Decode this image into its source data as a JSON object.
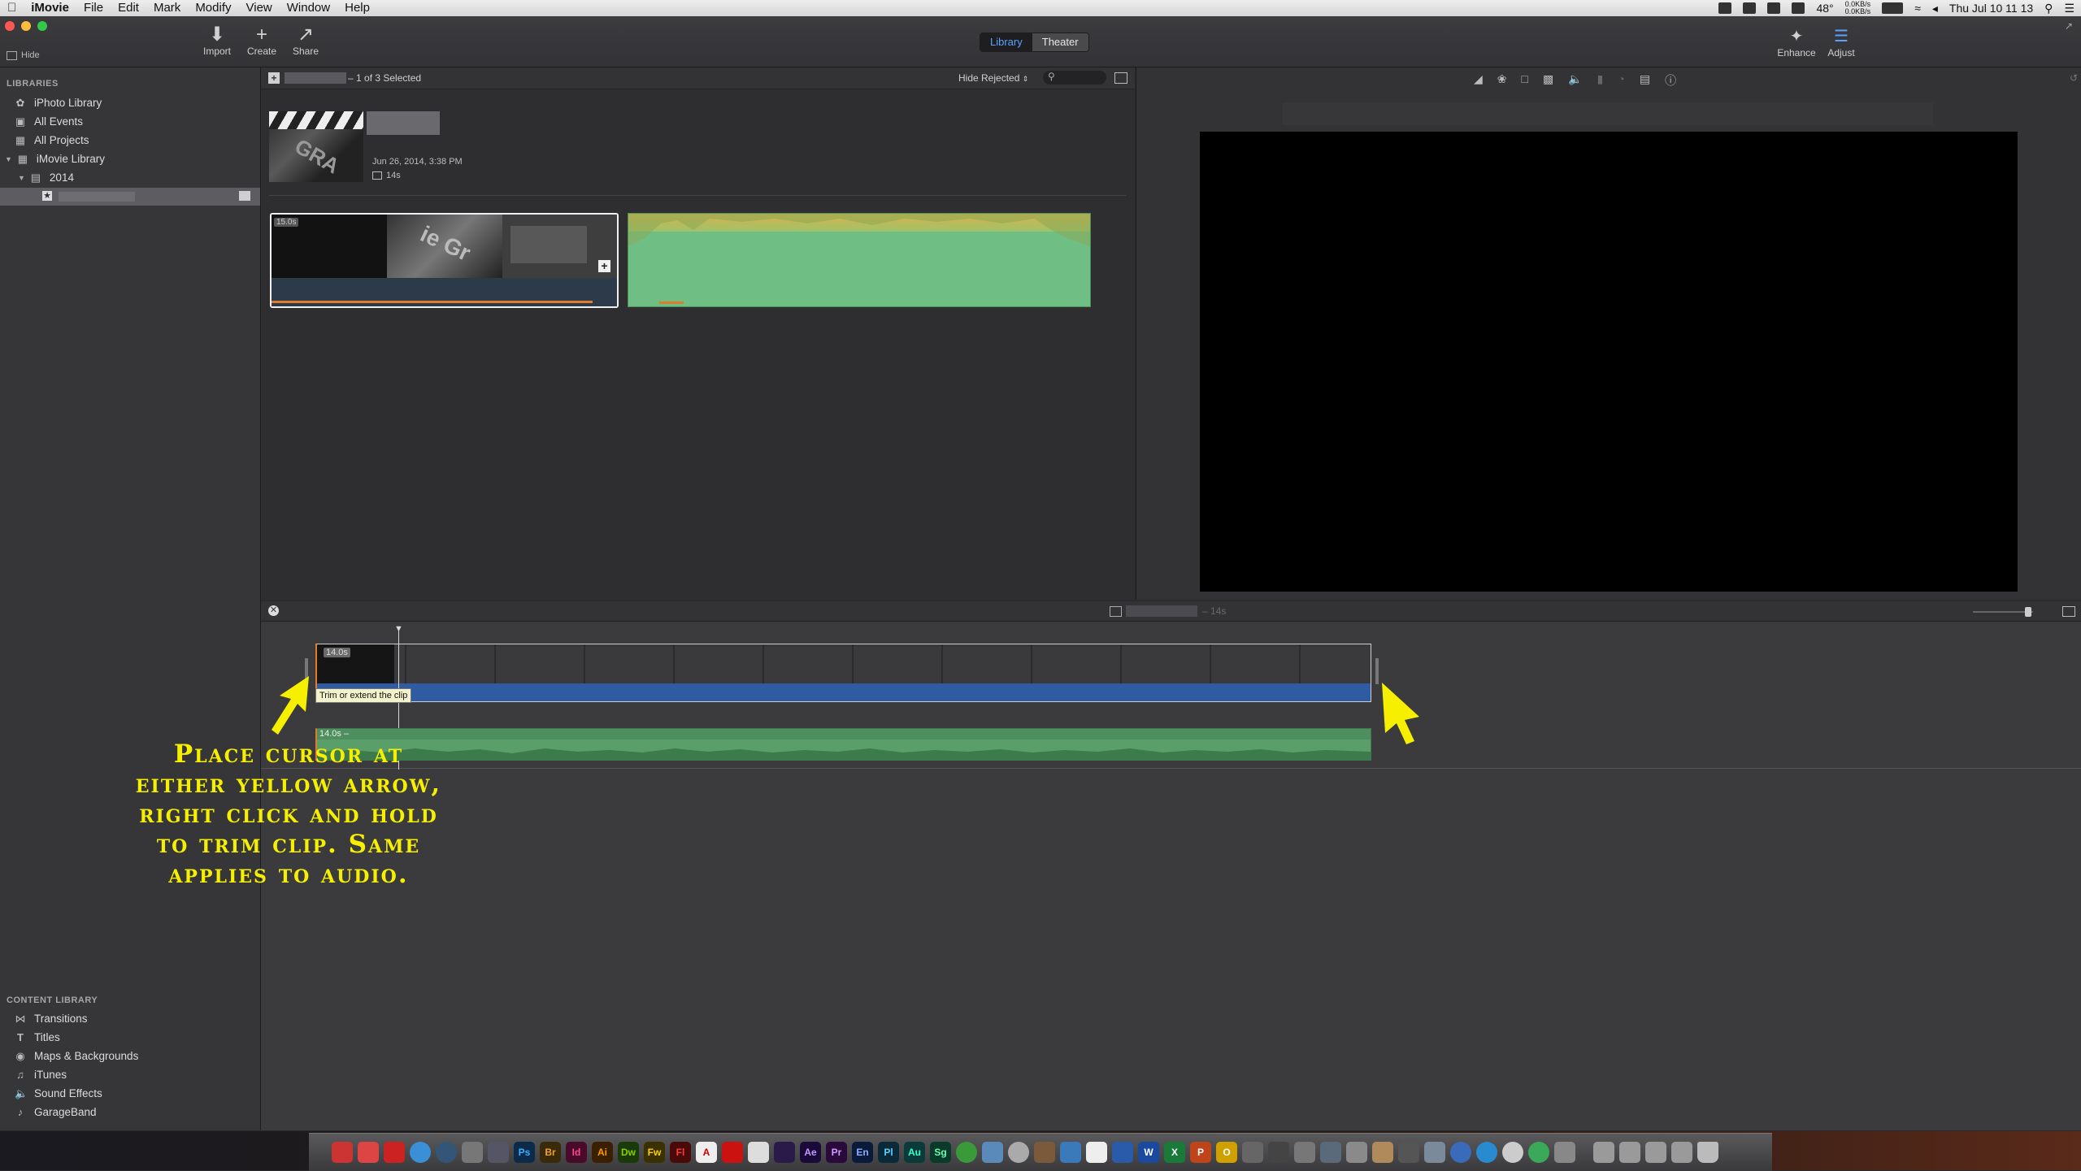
{
  "menubar": {
    "apple": "",
    "items": [
      "iMovie",
      "File",
      "Edit",
      "Mark",
      "Modify",
      "View",
      "Window",
      "Help"
    ],
    "temperature": "48°",
    "net_up": "0.0KB/s",
    "net_down": "0.0KB/s",
    "clock": "Thu Jul 10  11 13"
  },
  "toolbar": {
    "hide_label": "Hide",
    "import_label": "Import",
    "create_label": "Create",
    "share_label": "Share",
    "library_tab": "Library",
    "theater_tab": "Theater",
    "enhance_label": "Enhance",
    "adjust_label": "Adjust"
  },
  "sidebar": {
    "libraries_header": "LIBRARIES",
    "libraries": [
      {
        "label": "iPhoto Library",
        "icon": "iphoto-icon"
      },
      {
        "label": "All Events",
        "icon": "events-icon"
      },
      {
        "label": "All Projects",
        "icon": "projects-icon"
      },
      {
        "label": "iMovie Library",
        "icon": "library-icon"
      },
      {
        "label": "2014",
        "icon": "event-icon"
      }
    ],
    "content_header": "CONTENT LIBRARY",
    "content": [
      {
        "label": "Transitions",
        "icon": "transitions-icon"
      },
      {
        "label": "Titles",
        "icon": "titles-icon"
      },
      {
        "label": "Maps & Backgrounds",
        "icon": "globe-icon"
      },
      {
        "label": "iTunes",
        "icon": "music-note-icon"
      },
      {
        "label": "Sound Effects",
        "icon": "speaker-icon"
      },
      {
        "label": "GarageBand",
        "icon": "guitar-icon"
      }
    ]
  },
  "browser": {
    "selection_status": "– 1 of 3 Selected",
    "filter": "Hide Rejected",
    "project_date": "Jun 26, 2014, 3:38 PM",
    "project_duration": "14s",
    "clip_duration": "15.0s"
  },
  "timeline": {
    "duration": "– 14s",
    "video_clip_duration": "14.0s",
    "audio_clip_duration": "14.0s –",
    "tooltip": "Trim or extend the clip"
  },
  "annotation": {
    "lines": [
      "Place cursor at",
      "either yellow arrow,",
      "right click and hold",
      "to trim clip. Same",
      "applies to audio."
    ]
  },
  "dock": {
    "apps": [
      "Ps",
      "Br",
      "Id",
      "Ai",
      "Dw",
      "Fw",
      "Fl",
      "Ae",
      "Pr",
      "En",
      "Pl",
      "Au",
      "Sg",
      "W",
      "X",
      "P",
      "O"
    ]
  },
  "colors": {
    "accent_blue": "#3d7de3",
    "audio_green": "#6fbf85",
    "trim_arrow_yellow": "#f6f000",
    "selection_orange": "#e07a2c"
  }
}
